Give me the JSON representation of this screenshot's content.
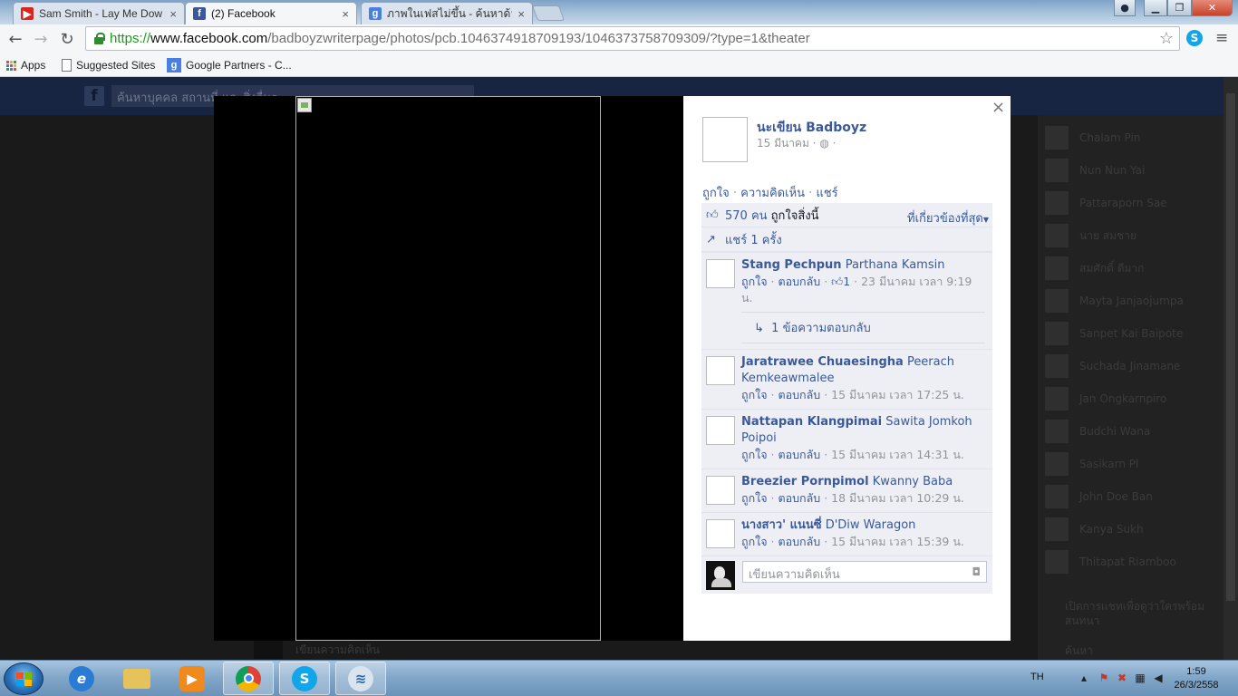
{
  "browser": {
    "tabs": [
      {
        "title": "Sam Smith - Lay Me Dow",
        "icon": "youtube-icon",
        "color": "#d9261c"
      },
      {
        "title": "(2) Facebook",
        "icon": "facebook-icon",
        "color": "#3b5998"
      },
      {
        "title": "ภาพในเฟสไม่ขึ้น - ค้นหาด้วย",
        "icon": "google-icon",
        "color": "#4a7fe0"
      }
    ],
    "close_glyph": "×",
    "url": {
      "scheme": "https://",
      "host": "www.facebook.com",
      "rest": "/badboyzwriterpage/photos/pcb.1046374918709193/1046373758709309/?type=1&theater"
    },
    "bookmarks": [
      {
        "label": "Apps",
        "icon": "apps-grid-icon"
      },
      {
        "label": "Suggested Sites",
        "icon": "page-icon"
      },
      {
        "label": "Google Partners - C...",
        "icon": "google-icon"
      }
    ]
  },
  "facebook_bg": {
    "search_placeholder": "ค้นหาบุคคล สถานที่ และสิ่งอื่นๆ",
    "chat_names": [
      "Chalam Pin",
      "Nun Nun Yai",
      "Pattaraporn Sae",
      "นาย สมชาย",
      "สมศักดิ์ ดีมาก",
      "Mayta Janjaojumpa",
      "Sanpet Kai Baipote",
      "Suchada Jinamane",
      "Jan Ongkarnpiro",
      "Budchi Wana",
      "Sasikarn Pl",
      "John Doe Ban",
      "Kanya Sukh",
      "Thitapat Riamboo"
    ],
    "bottom_comment": "เขียนความคิดเห็น",
    "chat_footer": "เปิดการแชทเพื่อดูว่าใครพร้อมสนทนา",
    "chat_search": "ค้นหา"
  },
  "post": {
    "page_name": "นะเขียน Badboyz",
    "date": "15 มีนาคม",
    "actions": [
      "ถูกใจ",
      "ความคิดเห็น",
      "แชร์"
    ],
    "likes_count": "570 คน",
    "likes_text": "ถูกใจสิ่งนี้",
    "sort_label": "ที่เกี่ยวข้องที่สุด",
    "shares": "แชร์ 1 ครั้ง",
    "close_glyph": "×"
  },
  "comments": [
    {
      "author": "Stang Pechpun",
      "tagged": "Parthana Kamsin",
      "like": "ถูกใจ",
      "reply": "ตอบกลับ",
      "likes": "1",
      "time": "23 มีนาคม เวลา 9:19 น.",
      "reply_link": "1 ข้อความตอบกลับ"
    },
    {
      "author": "Jaratrawee Chuaesingha",
      "tagged": "Peerach Kemkeawmalee",
      "like": "ถูกใจ",
      "reply": "ตอบกลับ",
      "time": "15 มีนาคม เวลา 17:25 น."
    },
    {
      "author": "Nattapan Klangpimai",
      "tagged": "Sawita Jomkoh Poipoi",
      "like": "ถูกใจ",
      "reply": "ตอบกลับ",
      "time": "15 มีนาคม เวลา 14:31 น."
    },
    {
      "author": "Breezier Pornpimol",
      "tagged": "Kwanny Baba",
      "like": "ถูกใจ",
      "reply": "ตอบกลับ",
      "time": "18 มีนาคม เวลา 10:29 น."
    },
    {
      "author": "นางสาว' แนนซี่",
      "tagged": "D'Diw Waragon",
      "like": "ถูกใจ",
      "reply": "ตอบกลับ",
      "time": "15 มีนาคม เวลา 15:39 น."
    }
  ],
  "compose": {
    "placeholder": "เขียนความคิดเห็น"
  },
  "taskbar": {
    "apps": [
      "internet-explorer-icon",
      "file-explorer-icon",
      "media-player-icon",
      "chrome-icon",
      "skype-icon",
      "network-app-icon"
    ],
    "language": "TH",
    "time": "1:59",
    "date": "26/3/2558"
  },
  "colors": {
    "fb_blue": "#3b5998",
    "fb_gray": "#90949c",
    "ufi_bg": "#edeff4"
  }
}
